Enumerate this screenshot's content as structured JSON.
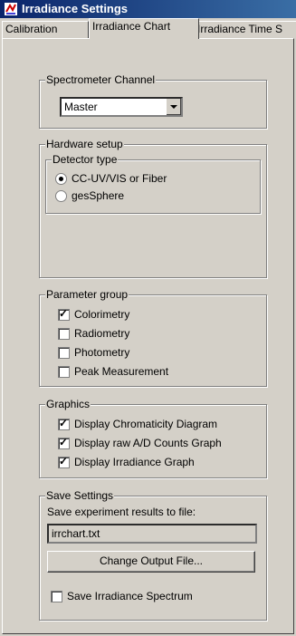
{
  "window": {
    "title": "Irradiance Settings"
  },
  "tabs": [
    {
      "label": "Calibration"
    },
    {
      "label": "Irradiance Chart"
    },
    {
      "label": "Irradiance Time S"
    }
  ],
  "spectrometer": {
    "legend": "Spectrometer Channel",
    "value": "Master"
  },
  "hardware": {
    "legend": "Hardware setup",
    "detector": {
      "legend": "Detector type",
      "options": [
        {
          "label": "CC-UV/VIS or Fiber",
          "checked": true
        },
        {
          "label": "gesSphere",
          "checked": false
        }
      ]
    }
  },
  "parameters": {
    "legend": "Parameter group",
    "items": [
      {
        "label": "Colorimetry",
        "checked": true
      },
      {
        "label": "Radiometry",
        "checked": false
      },
      {
        "label": "Photometry",
        "checked": false
      },
      {
        "label": "Peak Measurement",
        "checked": false
      }
    ]
  },
  "graphics": {
    "legend": "Graphics",
    "items": [
      {
        "label": "Display Chromaticity Diagram",
        "checked": true
      },
      {
        "label": "Display raw A/D Counts Graph",
        "checked": true
      },
      {
        "label": "Display Irradiance Graph",
        "checked": true
      }
    ]
  },
  "save": {
    "legend": "Save Settings",
    "caption": "Save experiment results to file:",
    "filename": "irrchart.txt",
    "button": "Change Output File...",
    "spectrum": {
      "label": "Save Irradiance Spectrum",
      "checked": false
    }
  }
}
